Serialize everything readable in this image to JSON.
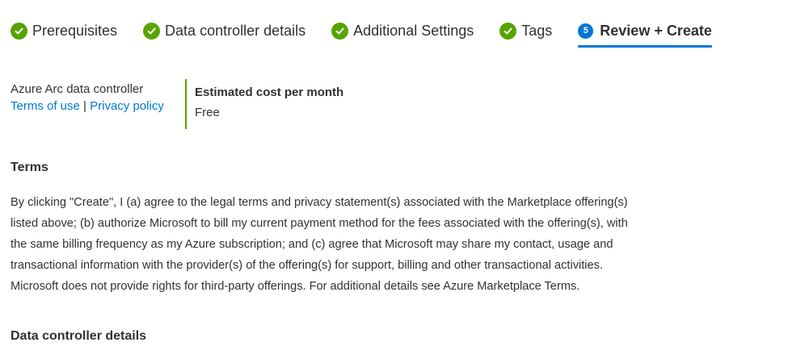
{
  "tabs": [
    {
      "label": "Prerequisites",
      "status": "complete"
    },
    {
      "label": "Data controller details",
      "status": "complete"
    },
    {
      "label": "Additional Settings",
      "status": "complete"
    },
    {
      "label": "Tags",
      "status": "complete"
    },
    {
      "label": "Review + Create",
      "status": "active",
      "step": "5"
    }
  ],
  "summary": {
    "product_name": "Azure Arc data controller",
    "terms_link": "Terms of use",
    "separator": "|",
    "privacy_link": "Privacy policy",
    "cost_title": "Estimated cost per month",
    "cost_value": "Free"
  },
  "terms": {
    "heading": "Terms",
    "lines": [
      "By clicking \"Create\", I (a) agree to the legal terms and privacy statement(s) associated with the Marketplace offering(s)",
      "listed above; (b) authorize Microsoft to bill my current payment method for the fees associated with the offering(s), with",
      "the same billing frequency as my Azure subscription; and (c) agree that Microsoft may share my contact, usage and",
      "transactional information with the provider(s) of the offering(s) for support, billing and other transactional activities.",
      "Microsoft does not provide rights for third-party offerings. For additional details see Azure Marketplace Terms."
    ]
  },
  "details": {
    "heading": "Data controller details"
  },
  "colors": {
    "accent": "#0078d4",
    "success": "#57a300",
    "text": "#323130"
  },
  "icons": {
    "complete": "checkmark-circle-icon",
    "active": "step-number-icon"
  }
}
